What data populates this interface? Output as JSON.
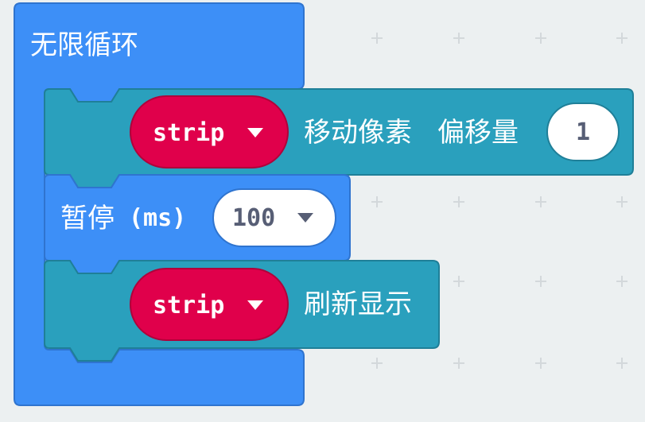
{
  "colors": {
    "workspace_bg": "#ecf0f1",
    "grid_cross": "#d3d8db",
    "loop_block": "#3d8ff7",
    "loop_block_border": "#2f74cf",
    "neopixel_block": "#2aa0bd",
    "neopixel_block_border": "#1f7f98",
    "variable_block": "#e0004b",
    "variable_block_border": "#b0003a",
    "value_field": "#ffffff",
    "value_text": "#575e75"
  },
  "forever_block": {
    "label": "无限循环"
  },
  "shift_block": {
    "variable": {
      "name": "strip",
      "dropdown_icon": "triangle-down-icon"
    },
    "label_action": "移动像素",
    "label_offset": "偏移量",
    "offset_value": "1"
  },
  "pause_block": {
    "label": "暂停",
    "unit": "(ms)",
    "value": "100",
    "dropdown_icon": "triangle-down-icon"
  },
  "show_block": {
    "variable": {
      "name": "strip",
      "dropdown_icon": "triangle-down-icon"
    },
    "label": "刷新显示"
  }
}
